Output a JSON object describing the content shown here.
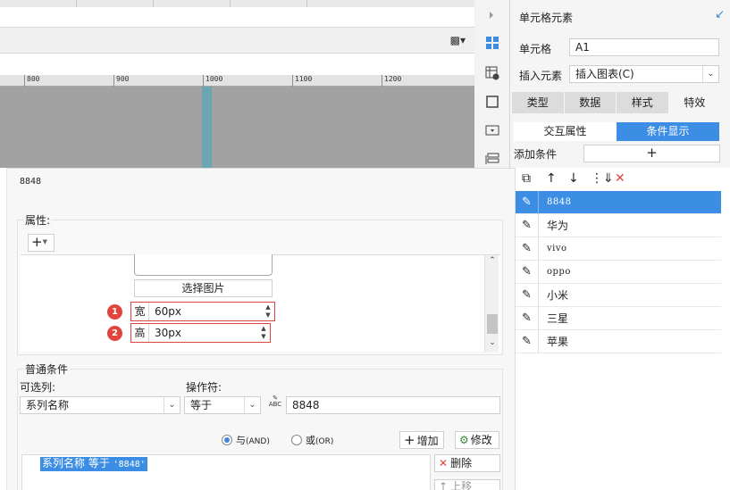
{
  "ruler": {
    "ticks": [
      "800",
      "900",
      "1000",
      "1100",
      "1200"
    ]
  },
  "right_panel": {
    "title": "单元格元素",
    "cell_label": "单元格",
    "cell_value": "A1",
    "insert_label": "插入元素",
    "insert_value": "插入图表(C)",
    "tabs": [
      "类型",
      "数据",
      "样式",
      "特效"
    ],
    "active_tab": "特效",
    "subtabs": [
      "交互属性",
      "条件显示"
    ],
    "active_subtab": "条件显示",
    "add_condition_label": "添加条件",
    "add_condition_button": "+"
  },
  "dialog": {
    "title": "8848",
    "attr_group_label": "属性:",
    "add_attr_button": "+",
    "pick_image_button": "选择图片",
    "width": {
      "label": "宽",
      "value": "60px",
      "badge": "1"
    },
    "height": {
      "label": "高",
      "value": "30px",
      "badge": "2"
    },
    "cond_group_label": "普通条件",
    "column_label": "可选列:",
    "column_value": "系列名称",
    "operator_label": "操作符:",
    "operator_value": "等于",
    "value_type_icon": "ABC",
    "value": "8848",
    "radio_and": "与",
    "radio_and_en": "(AND)",
    "radio_or": "或",
    "radio_or_en": "(OR)",
    "selected_radio": "and",
    "add_button": "增加",
    "modify_button": "修改",
    "delete_button": "删除",
    "move_up_button": "上移",
    "condition_text_main": "系列名称 等于 ",
    "condition_text_quoted": "'8848'"
  },
  "condition_list": {
    "items": [
      {
        "label": "8848",
        "selected": true,
        "mono": true
      },
      {
        "label": "华为",
        "selected": false,
        "mono": false
      },
      {
        "label": "vivo",
        "selected": false,
        "mono": true
      },
      {
        "label": "oppo",
        "selected": false,
        "mono": true
      },
      {
        "label": "小米",
        "selected": false,
        "mono": false
      },
      {
        "label": "三星",
        "selected": false,
        "mono": false
      },
      {
        "label": "苹果",
        "selected": false,
        "mono": false
      }
    ]
  },
  "colors": {
    "accent": "#3c8ee5",
    "highlight": "#e0443e",
    "canvas": "#a2a2a2",
    "selected_column": "#6ba7b2"
  }
}
